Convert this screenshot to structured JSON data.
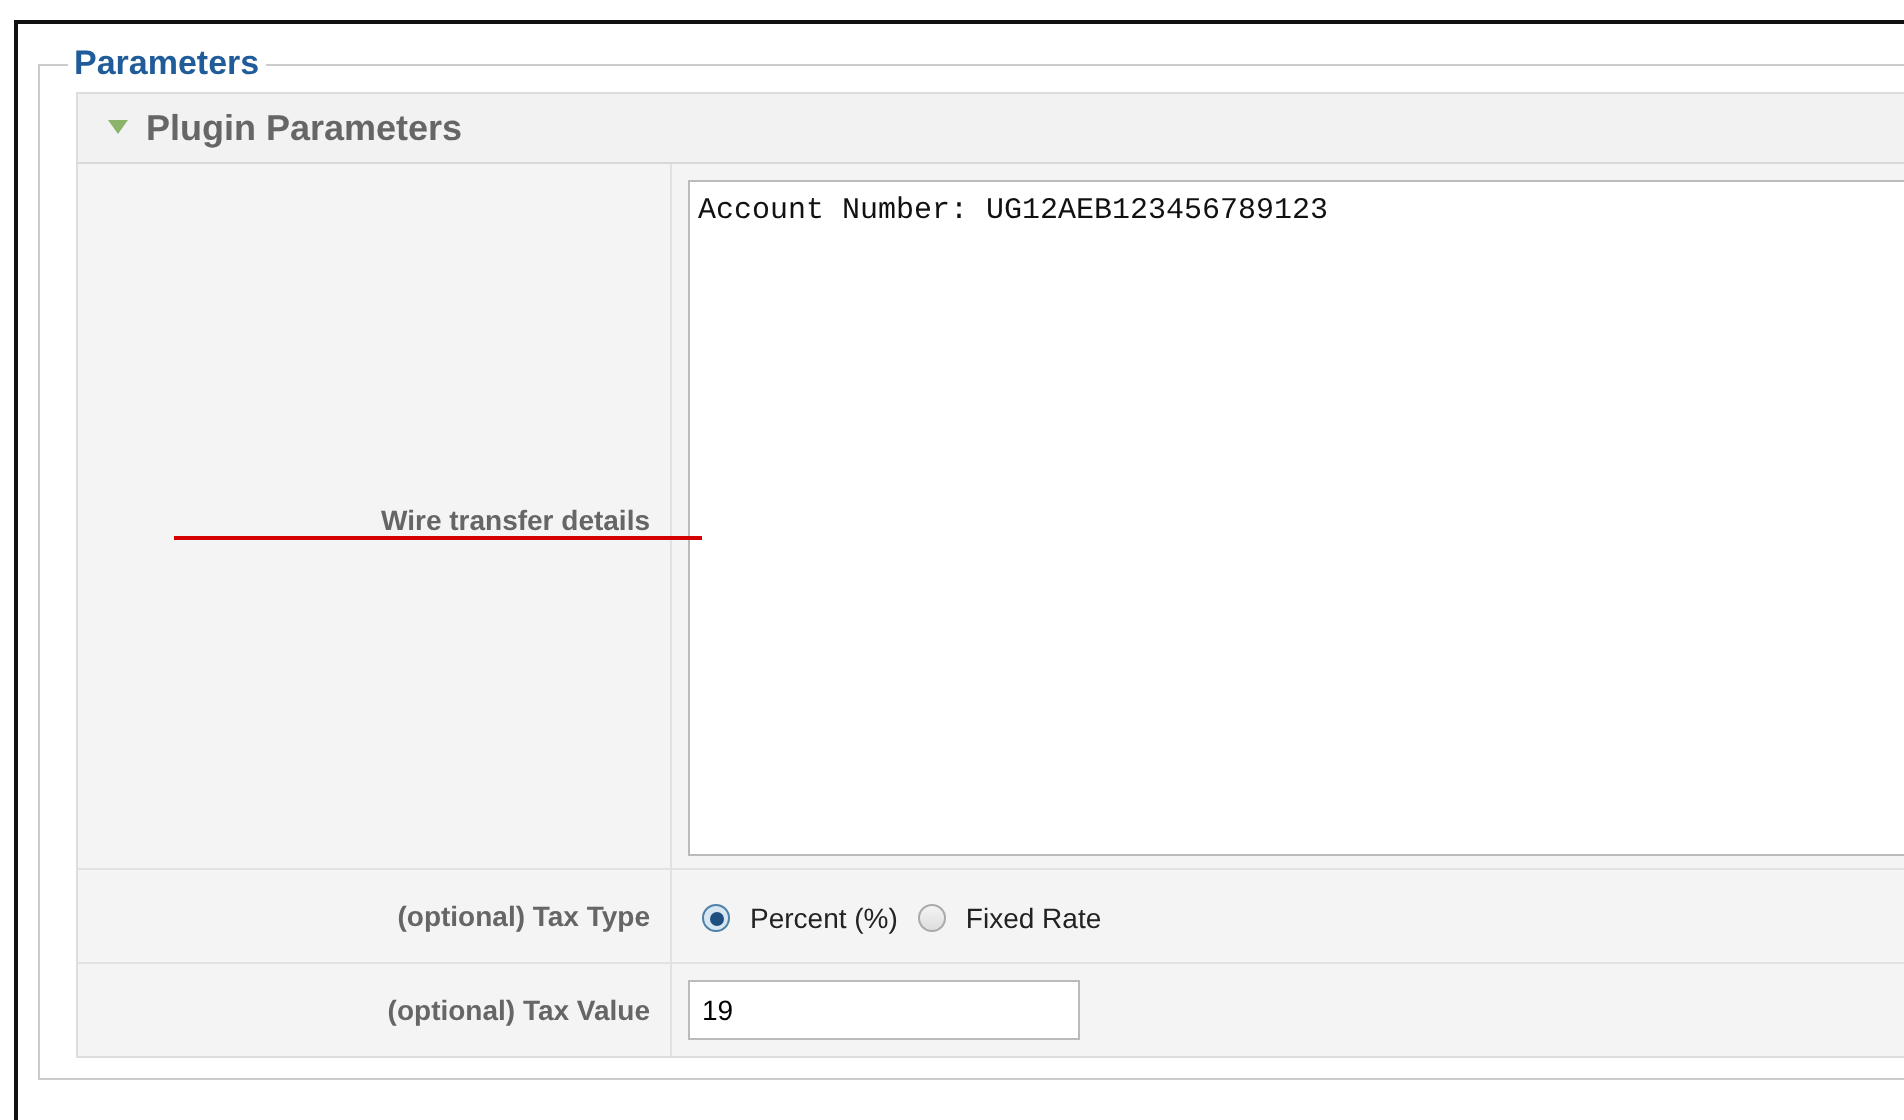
{
  "fieldset": {
    "legend": "Parameters"
  },
  "panel": {
    "title": "Plugin Parameters",
    "expanded": true
  },
  "wire_transfer": {
    "label": "Wire transfer details",
    "value": "Account Number: UG12AEB123456789123"
  },
  "tax_type": {
    "label": "(optional) Tax Type",
    "options": [
      {
        "label": "Percent (%)",
        "selected": true
      },
      {
        "label": "Fixed Rate",
        "selected": false
      }
    ]
  },
  "tax_value": {
    "label": "(optional) Tax Value",
    "value": "19"
  }
}
